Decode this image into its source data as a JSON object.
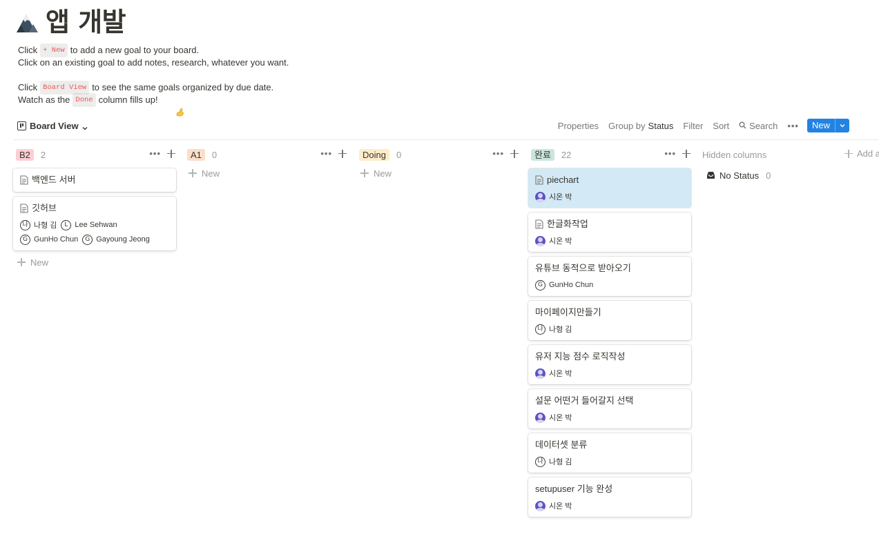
{
  "page": {
    "icon": "mountain-icon",
    "title": "앱 개발"
  },
  "description": {
    "line1_before": "Click",
    "line1_code": "+ New",
    "line1_after": "to add a new goal to your board.",
    "line2": "Click on an existing goal to add notes, research, whatever you want.",
    "line3_before": "Click",
    "line3_code": "Board View",
    "line3_after": "to see the same goals organized by due date.",
    "line4_before": "Watch as the",
    "line4_code": "Done",
    "line4_after": "column fills up!",
    "line4_emoji": "flexed-biceps-icon"
  },
  "toolbar": {
    "view_label": "Board View",
    "properties": "Properties",
    "group_by_label": "Group by",
    "group_by_value": "Status",
    "filter": "Filter",
    "sort": "Sort",
    "search": "Search",
    "more": "•••",
    "new_label": "New"
  },
  "columns": [
    {
      "tag": "B2",
      "tag_color": "#ffcdd2",
      "count": "2",
      "cards": [
        {
          "title": "백엔드 서버",
          "doc": true,
          "people": []
        },
        {
          "title": "깃허브",
          "doc": true,
          "people": [
            {
              "name": "나형 김",
              "avatar": "letter",
              "letter": "나"
            },
            {
              "name": "Lee Sehwan",
              "avatar": "letter",
              "letter": "L"
            },
            {
              "name": "GunHo Chun",
              "avatar": "letter",
              "letter": "G"
            },
            {
              "name": "Gayoung Jeong",
              "avatar": "letter",
              "letter": "G"
            }
          ]
        }
      ],
      "new_label": "New"
    },
    {
      "tag": "A1",
      "tag_color": "#fadec9",
      "count": "0",
      "cards": [],
      "new_label": "New"
    },
    {
      "tag": "Doing",
      "tag_color": "#fdecc8",
      "count": "0",
      "cards": [],
      "new_label": "New"
    },
    {
      "tag": "완료",
      "tag_color": "#c8e6df",
      "count": "22",
      "cards": [
        {
          "title": "piechart",
          "doc": true,
          "highlight": true,
          "people": [
            {
              "name": "시온 박",
              "avatar": "photo"
            }
          ]
        },
        {
          "title": "한글화작업",
          "doc": true,
          "people": [
            {
              "name": "시온 박",
              "avatar": "photo"
            }
          ]
        },
        {
          "title": "유튜브 동적으로 받아오기",
          "doc": false,
          "people": [
            {
              "name": "GunHo Chun",
              "avatar": "letter",
              "letter": "G"
            }
          ]
        },
        {
          "title": "마이페이지만들기",
          "doc": false,
          "people": [
            {
              "name": "나형 김",
              "avatar": "letter",
              "letter": "나"
            }
          ]
        },
        {
          "title": "유저 지능 점수 로직작성",
          "doc": false,
          "people": [
            {
              "name": "시온 박",
              "avatar": "photo"
            }
          ]
        },
        {
          "title": "설문 어떤거 들어갈지 선택",
          "doc": false,
          "people": [
            {
              "name": "시온 박",
              "avatar": "photo"
            }
          ]
        },
        {
          "title": "데이터셋 분류",
          "doc": false,
          "people": [
            {
              "name": "나형 김",
              "avatar": "letter",
              "letter": "나"
            }
          ]
        },
        {
          "title": "setupuser  기능 완성",
          "doc": false,
          "people": [
            {
              "name": "시온 박",
              "avatar": "photo"
            }
          ]
        }
      ],
      "new_label": ""
    }
  ],
  "hidden": {
    "label": "Hidden columns",
    "add_group": "Add a",
    "items": [
      {
        "label": "No Status",
        "count": "0",
        "icon": "inbox-icon"
      }
    ]
  }
}
